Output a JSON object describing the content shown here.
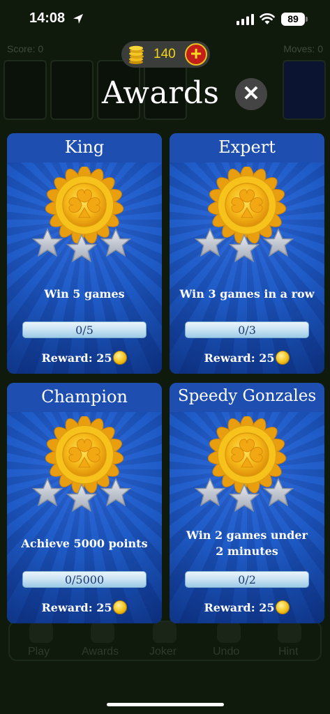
{
  "status_bar": {
    "time": "14:08",
    "battery": "89"
  },
  "background": {
    "score_label": "Score: 0",
    "moves_label": "Moves: 0",
    "tabs": [
      "Play",
      "Awards",
      "Joker",
      "Undo",
      "Hint"
    ]
  },
  "coins": {
    "value": "140",
    "add_label": "+"
  },
  "header": {
    "title": "Awards",
    "close_label": "✕"
  },
  "cards": [
    {
      "title": "King",
      "description": "Win 5 games",
      "progress_text": "0/5",
      "progress": 0,
      "reward_label": "Reward: 25"
    },
    {
      "title": "Expert",
      "description": "Win 3 games in a row",
      "progress_text": "0/3",
      "progress": 0,
      "reward_label": "Reward: 25"
    },
    {
      "title": "Champion",
      "description": "Achieve 5000 points",
      "progress_text": "0/5000",
      "progress": 0,
      "reward_label": "Reward: 25"
    },
    {
      "title": "Speedy Gonzales",
      "description_lines": [
        "Win 2 games under",
        "2 minutes"
      ],
      "progress_text": "0/2",
      "progress": 0,
      "reward_label": "Reward: 25"
    }
  ],
  "colors": {
    "card_blue": "#1f5cc8",
    "medal_gold": "#f4c51a",
    "coin_yellow": "#f3d318",
    "add_button_red": "#c31f1a",
    "star_silver": "#c7ccd6"
  }
}
